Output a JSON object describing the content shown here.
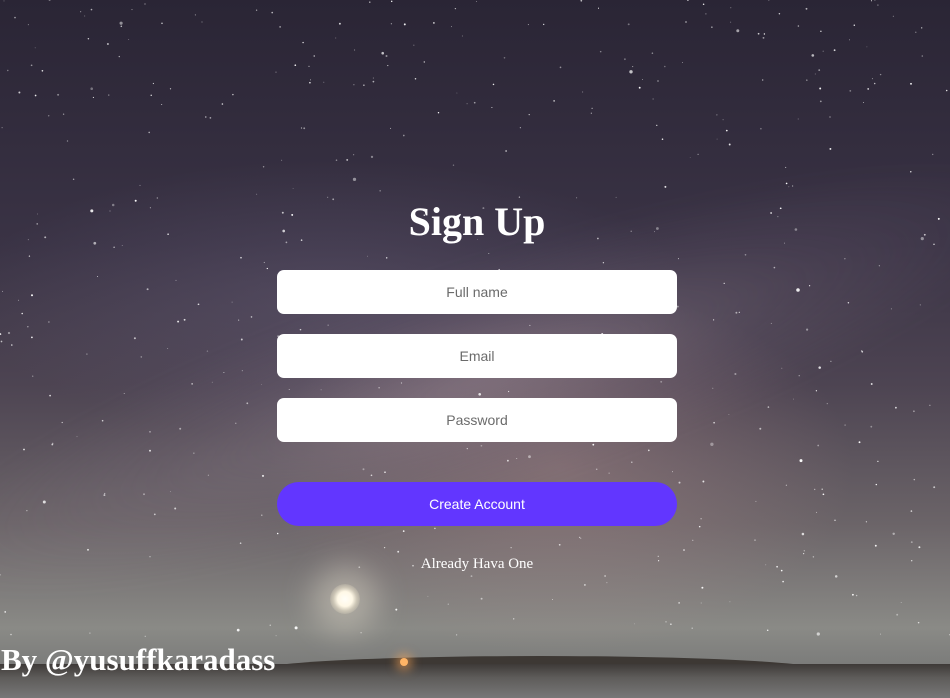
{
  "title": "Sign Up",
  "form": {
    "full_name_placeholder": "Full name",
    "email_placeholder": "Email",
    "password_placeholder": "Password",
    "submit_label": "Create Account",
    "login_link": "Already Hava One"
  },
  "credit": "By @yusuffkaradass",
  "colors": {
    "button": "#6236ff",
    "text": "#ffffff"
  }
}
